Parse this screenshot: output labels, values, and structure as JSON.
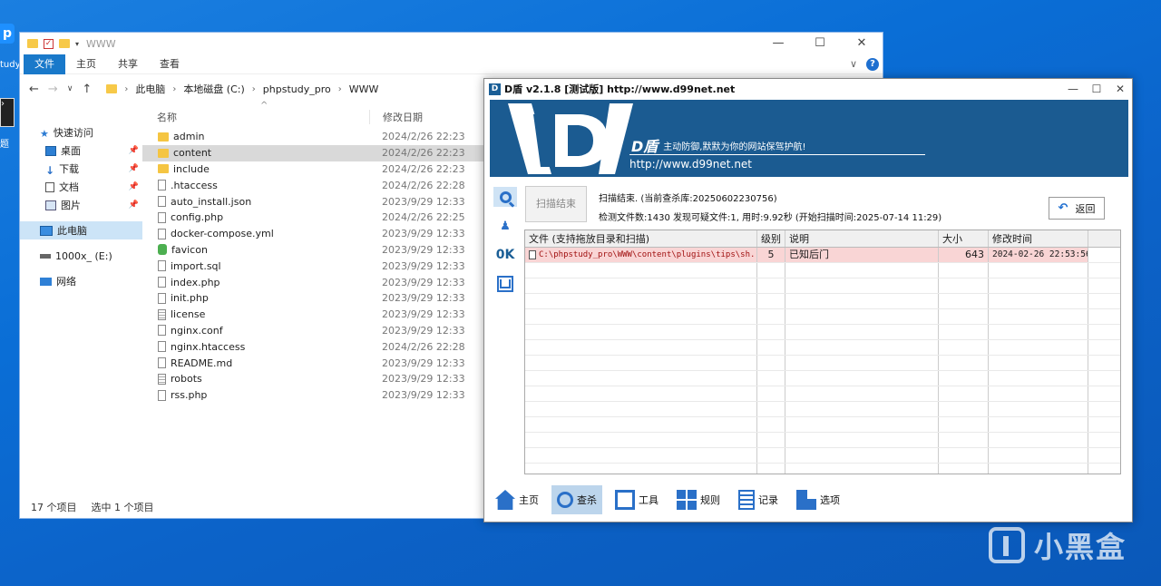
{
  "desktop": {
    "icon1_label": "tudy_",
    "icon1_glyph": "p",
    "icon2_glyph": "›",
    "icon2_label": "题",
    "watermark": "小黑盒"
  },
  "explorer": {
    "title": "WWW",
    "controls": {
      "minimize": "—",
      "maximize": "☐",
      "close": "✕"
    },
    "ribbon_tabs": [
      "文件",
      "主页",
      "共享",
      "查看"
    ],
    "ribbon_expand": "∨",
    "help": "?",
    "nav": {
      "back": "←",
      "forward": "→",
      "recent": "∨",
      "up": "↑"
    },
    "breadcrumb": [
      "此电脑",
      "本地磁盘 (C:)",
      "phpstudy_pro",
      "WWW"
    ],
    "breadcrumb_sep": "›",
    "sidebar": [
      {
        "label": "快速访问",
        "icon": "star-icon"
      },
      {
        "label": "桌面",
        "icon": "desktop-icon",
        "pin": true
      },
      {
        "label": "下载",
        "icon": "download-icon",
        "pin": true
      },
      {
        "label": "文档",
        "icon": "document-icon",
        "pin": true
      },
      {
        "label": "图片",
        "icon": "picture-icon",
        "pin": true
      },
      {
        "label": "此电脑",
        "icon": "computer-icon",
        "selected": true
      },
      {
        "label": "1000x_ (E:)",
        "icon": "drive-icon"
      },
      {
        "label": "网络",
        "icon": "network-icon"
      }
    ],
    "pin_glyph": "📌",
    "star_glyph": "★",
    "download_glyph": "↓",
    "columns": {
      "name": "名称",
      "date": "修改日期"
    },
    "files": [
      {
        "name": "admin",
        "date": "2024/2/26 22:23",
        "type": "folder"
      },
      {
        "name": "content",
        "date": "2024/2/26 22:23",
        "type": "folder",
        "selected": true
      },
      {
        "name": "include",
        "date": "2024/2/26 22:23",
        "type": "folder"
      },
      {
        "name": ".htaccess",
        "date": "2024/2/26 22:28",
        "type": "file"
      },
      {
        "name": "auto_install.json",
        "date": "2023/9/29 12:33",
        "type": "file"
      },
      {
        "name": "config.php",
        "date": "2024/2/26 22:25",
        "type": "file"
      },
      {
        "name": "docker-compose.yml",
        "date": "2023/9/29 12:33",
        "type": "file"
      },
      {
        "name": "favicon",
        "date": "2023/9/29 12:33",
        "type": "cactus"
      },
      {
        "name": "import.sql",
        "date": "2023/9/29 12:33",
        "type": "file"
      },
      {
        "name": "index.php",
        "date": "2023/9/29 12:33",
        "type": "file"
      },
      {
        "name": "init.php",
        "date": "2023/9/29 12:33",
        "type": "file"
      },
      {
        "name": "license",
        "date": "2023/9/29 12:33",
        "type": "text"
      },
      {
        "name": "nginx.conf",
        "date": "2023/9/29 12:33",
        "type": "file"
      },
      {
        "name": "nginx.htaccess",
        "date": "2024/2/26 22:28",
        "type": "file"
      },
      {
        "name": "README.md",
        "date": "2023/9/29 12:33",
        "type": "file"
      },
      {
        "name": "robots",
        "date": "2023/9/29 12:33",
        "type": "text"
      },
      {
        "name": "rss.php",
        "date": "2023/9/29 12:33",
        "type": "file"
      }
    ],
    "status": {
      "count": "17 个项目",
      "selected": "选中 1 个项目"
    }
  },
  "dshield": {
    "title": "D盾 v2.1.8 [测试版] http://www.d99net.net",
    "title_logo": "D",
    "controls": {
      "minimize": "—",
      "maximize": "☐",
      "close": "✕"
    },
    "banner": {
      "brand": "D盾",
      "slogan": "主动防御,默默为你的网站保驾护航!",
      "url": "http://www.d99net.net"
    },
    "side": {
      "ok": "0K"
    },
    "scan_button": "扫描结束",
    "info_line1": "扫描结束. (当前查杀库:20250602230756)",
    "info_line2": "检测文件数:1430 发现可疑文件:1, 用时:9.92秒 (开始扫描时间:2025-07-14 11:29)",
    "return_button": "返回",
    "return_glyph": "↶",
    "table": {
      "headers": [
        "文件 (支持拖放目录和扫描)",
        "级别",
        "说明",
        "大小",
        "修改时间"
      ],
      "rows": [
        {
          "file": "C:\\phpstudy_pro\\WWW\\content\\plugins\\tips\\sh...",
          "level": "5",
          "desc": "已知后门",
          "size": "643",
          "mtime": "2024-02-26 22:53:56"
        }
      ]
    },
    "bottom_nav": [
      {
        "label": "主页",
        "icon": "home-icon"
      },
      {
        "label": "查杀",
        "icon": "scan-icon",
        "active": true
      },
      {
        "label": "工具",
        "icon": "tools-icon"
      },
      {
        "label": "规则",
        "icon": "rules-icon"
      },
      {
        "label": "记录",
        "icon": "log-icon"
      },
      {
        "label": "选项",
        "icon": "options-icon"
      }
    ]
  }
}
